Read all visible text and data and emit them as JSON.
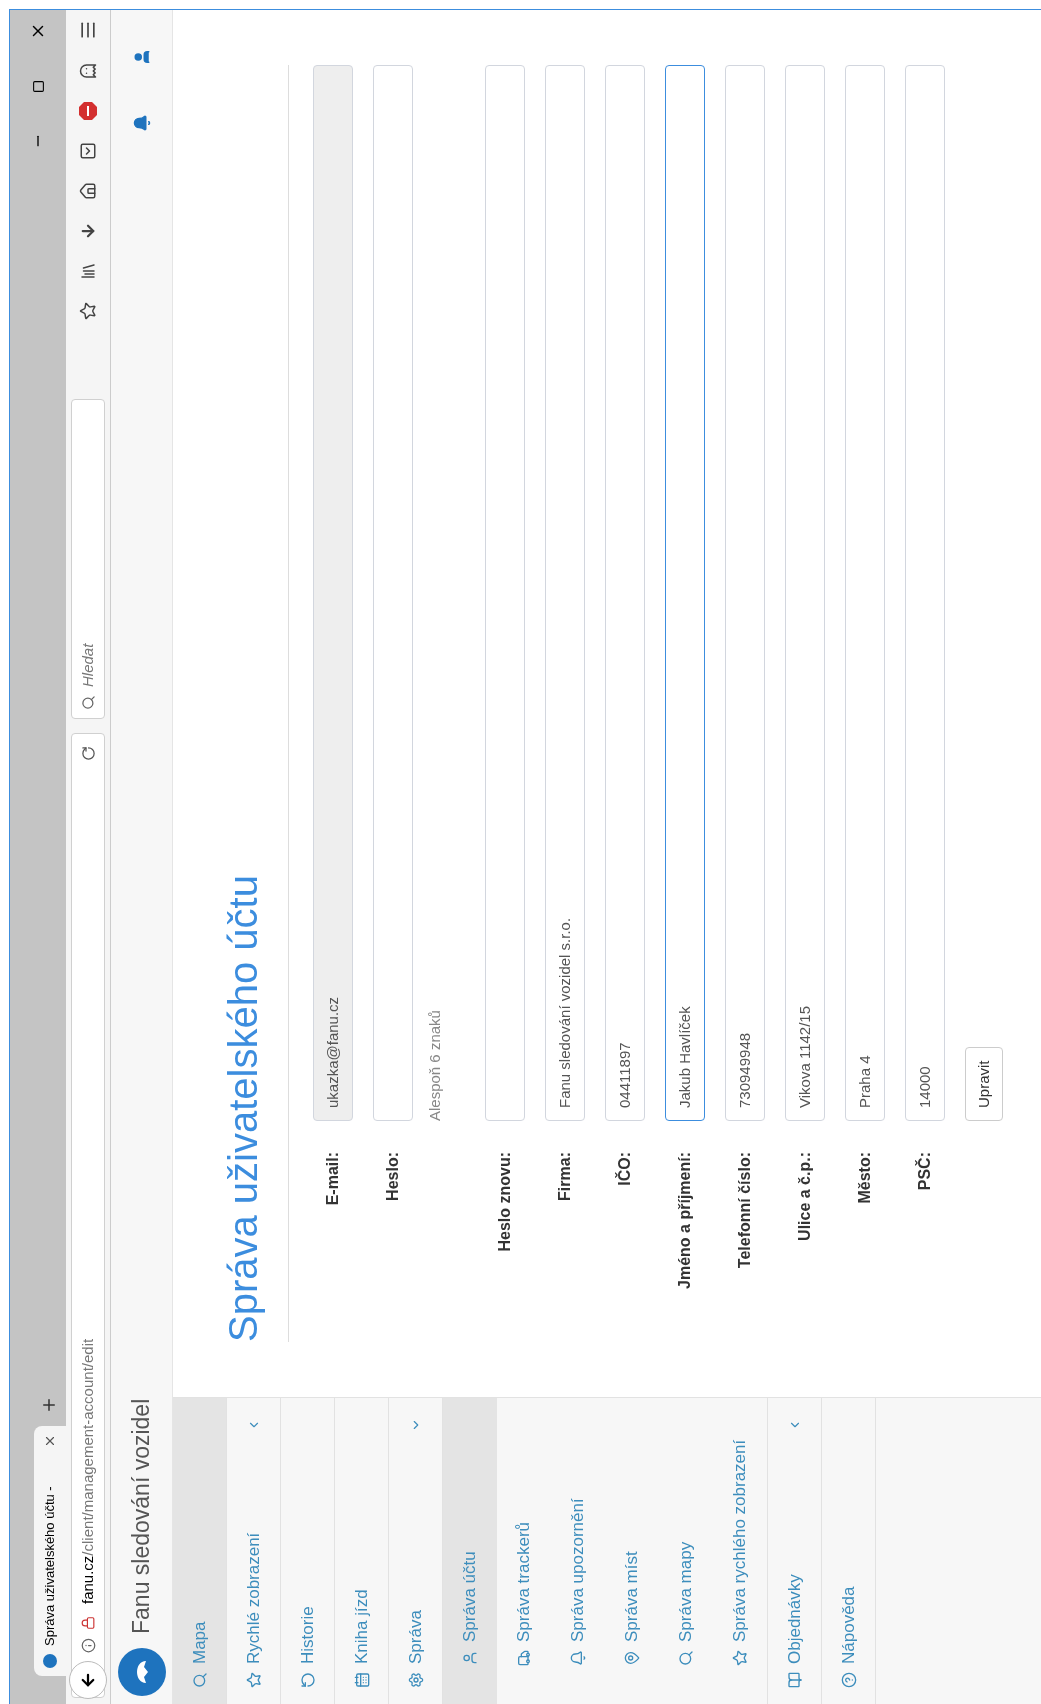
{
  "browser": {
    "tab": {
      "title": "Správa uživatelského účtu -",
      "selected": true
    },
    "url_host": "fanu.cz",
    "url_path": "/client/management-account/edit",
    "search": {
      "placeholder": "Hledat"
    }
  },
  "header": {
    "title": "Fanu sledování vozidel"
  },
  "sidebar": {
    "items": [
      {
        "label": "Mapa",
        "selected": true
      },
      {
        "label": "Rychlé zobrazení",
        "selected": false,
        "expanded": false
      },
      {
        "label": "Historie",
        "selected": false
      },
      {
        "label": "Kniha jízd",
        "selected": false
      },
      {
        "label": "Správa",
        "selected": false,
        "expanded": true,
        "children": [
          {
            "label": "Správa účtu",
            "selected": true
          },
          {
            "label": "Správa trackerů",
            "selected": false
          },
          {
            "label": "Správa upozornění",
            "selected": false
          },
          {
            "label": "Správa míst",
            "selected": false
          },
          {
            "label": "Správa mapy",
            "selected": false
          },
          {
            "label": "Správa rychlého zobrazení",
            "selected": false
          }
        ]
      },
      {
        "label": "Objednávky",
        "selected": false,
        "expanded": false
      },
      {
        "label": "Nápověda",
        "selected": false
      }
    ]
  },
  "page": {
    "title": "Správa uživatelského účtu"
  },
  "form": {
    "fields": [
      {
        "label": "E-mail:",
        "value": "ukazka@fanu.cz",
        "disabled": true,
        "focused": false
      },
      {
        "label": "Heslo:",
        "hint": "Alespoň 6 znaků",
        "disabled": false,
        "focused": false
      },
      {
        "label": "Heslo znovu:",
        "disabled": false,
        "focused": false
      },
      {
        "label": "Firma:",
        "value": "Fanu sledování vozidel s.r.o.",
        "disabled": false,
        "focused": false
      },
      {
        "label": "IČO:",
        "value": "04411897",
        "disabled": false,
        "focused": false
      },
      {
        "label": "Jméno a příjmení:",
        "value": "Jakub Havlíček",
        "disabled": false,
        "focused": true
      },
      {
        "label": "Telefonní číslo:",
        "value": "730949948",
        "disabled": false,
        "focused": false
      },
      {
        "label": "Ulice a č.p.:",
        "value": "Vikova 1142/15",
        "disabled": false,
        "focused": false
      },
      {
        "label": "Město:",
        "value": "Praha 4",
        "disabled": false,
        "focused": false
      },
      {
        "label": "PSČ:",
        "value": "14000",
        "disabled": false,
        "focused": false
      }
    ],
    "submit": "Upravit"
  }
}
